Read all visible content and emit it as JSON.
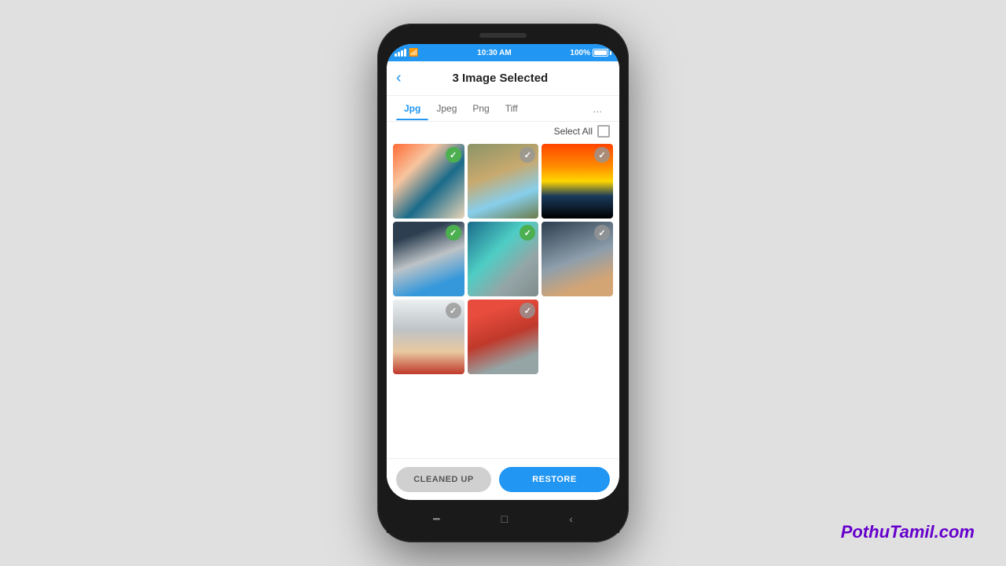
{
  "status_bar": {
    "time": "10:30 AM",
    "battery_pct": "100%",
    "bg_color": "#2196F3"
  },
  "header": {
    "title": "3 Image Selected",
    "back_label": "‹"
  },
  "tabs": [
    {
      "label": "Jpg",
      "active": true
    },
    {
      "label": "Jpeg",
      "active": false
    },
    {
      "label": "Png",
      "active": false
    },
    {
      "label": "Tiff",
      "active": false
    },
    {
      "label": "...",
      "active": false
    }
  ],
  "select_all": {
    "label": "Select All"
  },
  "images": [
    {
      "id": 1,
      "check": "green",
      "css_class": "img-1"
    },
    {
      "id": 2,
      "check": "gray",
      "css_class": "img-2"
    },
    {
      "id": 3,
      "check": "gray",
      "css_class": "img-3"
    },
    {
      "id": 4,
      "check": "green",
      "css_class": "img-4"
    },
    {
      "id": 5,
      "check": "green",
      "css_class": "img-5"
    },
    {
      "id": 6,
      "check": "gray",
      "css_class": "img-6"
    },
    {
      "id": 7,
      "check": "gray",
      "css_class": "img-7"
    },
    {
      "id": 8,
      "check": "gray",
      "css_class": "img-8"
    }
  ],
  "buttons": {
    "cleaned_up": "CLEANED UP",
    "restore": "RESTORE"
  },
  "watermark": "PothuTamil.com"
}
